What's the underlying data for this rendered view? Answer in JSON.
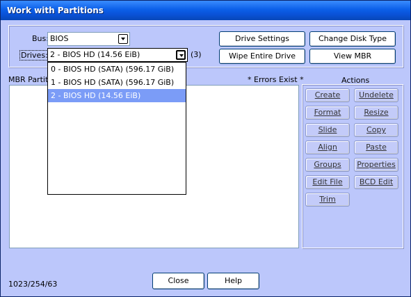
{
  "window": {
    "title": "Work with Partitions"
  },
  "bus": {
    "label": "Bus:",
    "value": "BIOS"
  },
  "drives": {
    "label": "Drives:",
    "value": "2 - BIOS HD (14.56 EiB)",
    "count": "(3)",
    "options": [
      "0 - BIOS HD (SATA) (596.17 GiB)",
      "1 - BIOS HD (SATA) (596.17 GiB)",
      "2 - BIOS HD (14.56 EiB)"
    ],
    "selected_index": 2
  },
  "toolbar": {
    "drive_settings": "Drive Settings",
    "change_disk_type": "Change Disk Type",
    "wipe_entire_drive": "Wipe Entire Drive",
    "view_mbr": "View MBR"
  },
  "partitions": {
    "label": "MBR Partitio",
    "errors": "* Errors Exist *"
  },
  "actions": {
    "title": "Actions",
    "create": "Create",
    "undelete": "Undelete",
    "format": "Format",
    "resize": "Resize",
    "slide": "Slide",
    "copy": "Copy",
    "align": "Align",
    "paste": "Paste",
    "groups": "Groups",
    "properties": "Properties",
    "edit_file": "Edit File",
    "bcd_edit": "BCD Edit",
    "trim": "Trim"
  },
  "footer": {
    "geometry": "1023/254/63",
    "close": "Close",
    "help": "Help"
  }
}
